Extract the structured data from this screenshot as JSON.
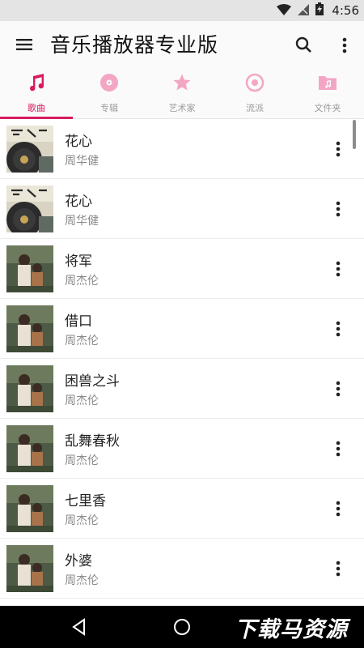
{
  "status_bar": {
    "time": "4:56"
  },
  "app_bar": {
    "title": "音乐播放器专业版"
  },
  "accent_color": "#d81b60",
  "tabs": [
    {
      "label": "歌曲",
      "icon": "music-note-icon",
      "active": true
    },
    {
      "label": "专辑",
      "icon": "disc-icon",
      "active": false
    },
    {
      "label": "艺术家",
      "icon": "star-icon",
      "active": false
    },
    {
      "label": "流派",
      "icon": "vinyl-icon",
      "active": false
    },
    {
      "label": "文件夹",
      "icon": "folder-music-icon",
      "active": false
    }
  ],
  "songs": [
    {
      "title": "花心",
      "artist": "周华健",
      "cover": "album-cover-zhou-huajian"
    },
    {
      "title": "花心",
      "artist": "周华健",
      "cover": "album-cover-zhou-huajian"
    },
    {
      "title": "将军",
      "artist": "周杰伦",
      "cover": "album-cover-jay-chou"
    },
    {
      "title": "借口",
      "artist": "周杰伦",
      "cover": "album-cover-jay-chou"
    },
    {
      "title": "困兽之斗",
      "artist": "周杰伦",
      "cover": "album-cover-jay-chou"
    },
    {
      "title": "乱舞春秋",
      "artist": "周杰伦",
      "cover": "album-cover-jay-chou"
    },
    {
      "title": "七里香",
      "artist": "周杰伦",
      "cover": "album-cover-jay-chou"
    },
    {
      "title": "外婆",
      "artist": "周杰伦",
      "cover": "album-cover-jay-chou"
    }
  ],
  "watermark": {
    "text": "下载马资源"
  }
}
